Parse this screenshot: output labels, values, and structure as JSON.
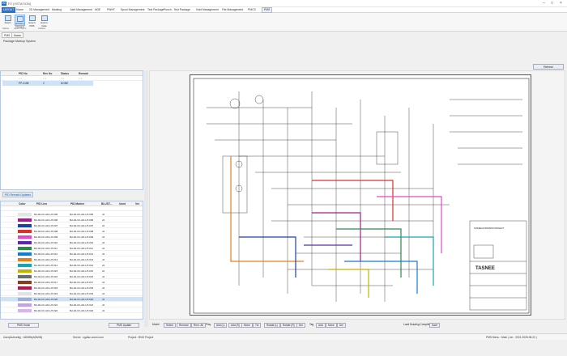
{
  "window": {
    "app_title": "P2 (VSTATION)",
    "logo": "P2"
  },
  "menu": [
    {
      "label": "LAYOUT",
      "active": true
    },
    {
      "label": "Home"
    },
    {
      "label": "2D Management"
    },
    {
      "label": "Marking"
    },
    {
      "label": "Joint Management"
    },
    {
      "label": "NDE"
    },
    {
      "label": "PWHT"
    },
    {
      "label": "Spool Management"
    },
    {
      "label": "Test Package"
    },
    {
      "label": "Punch - Test Package"
    },
    {
      "label": "Hold Management"
    },
    {
      "label": "File Management"
    },
    {
      "label": "PMCS"
    },
    {
      "label": "PMS",
      "selected": true
    }
  ],
  "ribbon": {
    "buttons": [
      {
        "label": "Attach",
        "group": "Status"
      },
      {
        "label": "Drawing Changes",
        "group": "Action Items",
        "selected": true
      },
      {
        "label": "Export PMS"
      },
      {
        "label": "Export Data"
      }
    ],
    "groups": [
      "Status",
      "Action Items",
      "Utilities"
    ]
  },
  "doc_tabs": [
    "PMS",
    "Home"
  ],
  "panel_title": "Package Markup System",
  "refresh_label": "Refresh",
  "pid_table": {
    "headers": [
      "PID No",
      "Rev No",
      "Status",
      "Remark"
    ],
    "row": {
      "pid": "PP-0198",
      "rev": "2",
      "status": "DONE"
    }
  },
  "pid_tab_label": "PID Remark Updates",
  "line_table": {
    "headers": [
      "Color",
      "PID Line",
      "PID Marker",
      "BLUST...",
      "Used",
      "Ver"
    ],
    "rows": [
      {
        "color": "#e5e5e5",
        "tag": "8H-02-CF-AD-HT-005",
        "tag2": "8H-02-CF-AD-HT-005",
        "ver": "v0"
      },
      {
        "color": "#a01f8c",
        "tag": "8H-02-CF-AD-HT-006",
        "tag2": "8H-02-CF-AD-HT-006",
        "ver": "v0"
      },
      {
        "color": "#1f3fa6",
        "tag": "8H-02-CF-AD-HT-007",
        "tag2": "8H-02-CF-AD-HT-007",
        "ver": "v0"
      },
      {
        "color": "#d93030",
        "tag": "8H-02-CF-AD-HT-008",
        "tag2": "8H-02-CF-AD-HT-008",
        "ver": "v0"
      },
      {
        "color": "#e04ac8",
        "tag": "8H-02-CF-AD-HT-009",
        "tag2": "8H-02-CF-AD-HT-009",
        "ver": "v0"
      },
      {
        "color": "#5a2aa8",
        "tag": "8H-02-CF-AD-HT-010",
        "tag2": "8H-02-CF-AD-HT-010",
        "ver": "v0"
      },
      {
        "color": "#2a8a4a",
        "tag": "8H-02-CF-AD-HT-011",
        "tag2": "8H-02-CF-AD-HT-011",
        "ver": "v0"
      },
      {
        "color": "#1a7ad0",
        "tag": "8H-02-CF-AD-HT-012",
        "tag2": "8H-02-CF-AD-HT-012",
        "ver": "v0"
      },
      {
        "color": "#e08020",
        "tag": "8H-02-CF-AD-HT-013",
        "tag2": "8H-02-CF-AD-HT-013",
        "ver": "v0"
      },
      {
        "color": "#17a2b8",
        "tag": "8H-02-CF-AD-HT-014",
        "tag2": "8H-02-CF-AD-HT-014",
        "ver": "v0"
      },
      {
        "color": "#c0b400",
        "tag": "8H-02-CF-AD-HT-015",
        "tag2": "8H-02-CF-AD-HT-015",
        "ver": "v0"
      },
      {
        "color": "#6d6d6d",
        "tag": "8H-02-CF-AD-HT-016",
        "tag2": "8H-02-CF-AD-HT-016",
        "ver": "v0"
      },
      {
        "color": "#8a3c1f",
        "tag": "8H-02-CF-AD-HT-017",
        "tag2": "8H-02-CF-AD-HT-017",
        "ver": "v0"
      },
      {
        "color": "#b31657",
        "tag": "8H-02-CF-AD-HT-018",
        "tag2": "8H-02-CF-AD-HT-018",
        "ver": "v0"
      },
      {
        "color": "#e2e2e2",
        "tag": "8H-02-CF-AD-HT-019",
        "tag2": "8H-02-CF-AD-HT-019",
        "ver": "v0"
      },
      {
        "color": "#9ab0d8",
        "tag": "8H-02-CF-AD-HT-020",
        "tag2": "8H-02-CF-AD-HT-020",
        "ver": "v0"
      },
      {
        "color": "#c6a0e0",
        "tag": "8H-02-CF-AD-HT-021",
        "tag2": "8H-02-CF-AD-HT-021",
        "ver": "v0"
      },
      {
        "color": "#d7b6e8",
        "tag": "8H-02-CF-AD-HT-022",
        "tag2": "8H-02-CF-AD-HT-022",
        "ver": "v0"
      }
    ]
  },
  "left_buttons": [
    "PMS Home",
    "PMS Update"
  ],
  "drawing": {
    "title_block_company": "TASNEE",
    "project": "TASNEE EXPANSION PROJECT"
  },
  "bottom_toolbar": [
    {
      "label": "Model",
      "btn": false
    },
    {
      "label": "Select",
      "btn": true
    },
    {
      "label": "Remove",
      "btn": true
    },
    {
      "label": "Rem. All",
      "btn": true
    },
    {
      "label": "Play",
      "btn": false
    },
    {
      "label": "Add (L)",
      "btn": true
    },
    {
      "label": "Add (R)",
      "btn": true
    },
    {
      "label": "Move",
      "btn": true
    },
    {
      "label": "Txt",
      "btn": true
    },
    {
      "label": "Rotate (L)",
      "btn": true
    },
    {
      "label": "Rotate (R)",
      "btn": true
    },
    {
      "label": "Del",
      "btn": true
    },
    {
      "label": "Tag",
      "btn": false
    },
    {
      "label": "Add",
      "btn": true
    },
    {
      "label": "Move",
      "btn": true
    },
    {
      "label": "Del",
      "btn": true
    },
    {
      "label": "Load Drawing Completed",
      "btn": false
    },
    {
      "label": "Save",
      "btn": true
    }
  ],
  "status": {
    "user": "User(Authority) : ADMIN(ADMIN)",
    "server": "Server : vgdisz.conxt.com",
    "project": "Project : BNG Project",
    "right": "PMS   Menu : Main   | ver : 2021.2025.06.22 |"
  },
  "colors": {
    "accent": "#2b73c9",
    "selection": "#cde4f8"
  }
}
